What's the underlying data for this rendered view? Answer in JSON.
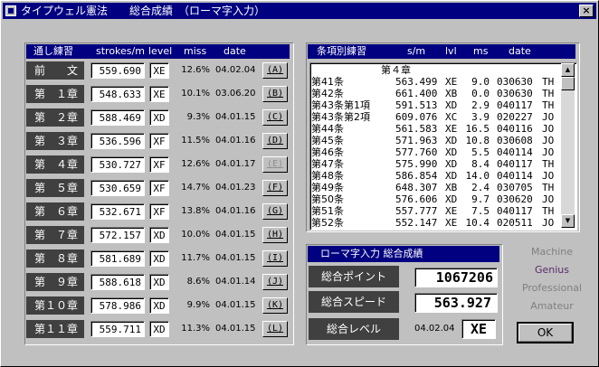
{
  "window": {
    "title": "タイプウェル憲法　　総合成績　（ローマ字入力）",
    "close_glyph": "×"
  },
  "left": {
    "header": {
      "col1": "通し練習",
      "col2": "strokes/m",
      "col3": "level",
      "col4": "miss",
      "col5": "date"
    },
    "rows": [
      {
        "label_a": "前",
        "label_b": "文",
        "spm": "559.690",
        "level": "XE",
        "miss": "12.6%",
        "date": "04.02.04",
        "key": "(A)"
      },
      {
        "label_a": "第",
        "label_b": "１章",
        "spm": "548.633",
        "level": "XE",
        "miss": "10.1%",
        "date": "03.06.20",
        "key": "(B)"
      },
      {
        "label_a": "第",
        "label_b": "２章",
        "spm": "588.469",
        "level": "XD",
        "miss": "9.3%",
        "date": "04.01.15",
        "key": "(C)"
      },
      {
        "label_a": "第",
        "label_b": "３章",
        "spm": "536.596",
        "level": "XF",
        "miss": "11.5%",
        "date": "04.01.16",
        "key": "(D)"
      },
      {
        "label_a": "第",
        "label_b": "４章",
        "spm": "530.727",
        "level": "XF",
        "miss": "12.6%",
        "date": "04.01.17",
        "key": "(E)"
      },
      {
        "label_a": "第",
        "label_b": "５章",
        "spm": "530.659",
        "level": "XF",
        "miss": "14.7%",
        "date": "04.01.23",
        "key": "(F)"
      },
      {
        "label_a": "第",
        "label_b": "６章",
        "spm": "532.671",
        "level": "XF",
        "miss": "13.8%",
        "date": "04.01.16",
        "key": "(G)"
      },
      {
        "label_a": "第",
        "label_b": "７章",
        "spm": "572.157",
        "level": "XD",
        "miss": "10.0%",
        "date": "04.01.15",
        "key": "(H)"
      },
      {
        "label_a": "第",
        "label_b": "８章",
        "spm": "581.689",
        "level": "XD",
        "miss": "11.7%",
        "date": "04.01.15",
        "key": "(I)"
      },
      {
        "label_a": "第",
        "label_b": "９章",
        "spm": "588.618",
        "level": "XD",
        "miss": "8.6%",
        "date": "04.01.14",
        "key": "(J)"
      },
      {
        "label_a": "第",
        "label_b": "１０章",
        "spm": "578.986",
        "level": "XD",
        "miss": "9.9%",
        "date": "04.01.15",
        "key": "(K)"
      },
      {
        "label_a": "第",
        "label_b": "１１章",
        "spm": "559.711",
        "level": "XD",
        "miss": "11.3%",
        "date": "04.01.15",
        "key": "(L)"
      }
    ]
  },
  "right": {
    "header": {
      "col1": "条項別練習",
      "col2": "s/m",
      "col3": "lvl",
      "col4": "ms",
      "col5": "date"
    },
    "chapter": "第４章",
    "items": [
      {
        "name": "第41条",
        "sm": "563.499",
        "lvl": "XE",
        "ms": "9.0",
        "date": "030630",
        "who": "TH"
      },
      {
        "name": "第42条",
        "sm": "661.400",
        "lvl": "XB",
        "ms": "0.0",
        "date": "030630",
        "who": "TH"
      },
      {
        "name": "第43条第1項",
        "sm": "591.513",
        "lvl": "XD",
        "ms": "2.9",
        "date": "040117",
        "who": "TH"
      },
      {
        "name": "第43条第2項",
        "sm": "609.076",
        "lvl": "XC",
        "ms": "3.9",
        "date": "020227",
        "who": "JO"
      },
      {
        "name": "第44条",
        "sm": "561.583",
        "lvl": "XE",
        "ms": "16.5",
        "date": "040116",
        "who": "JO"
      },
      {
        "name": "第45条",
        "sm": "571.963",
        "lvl": "XD",
        "ms": "10.8",
        "date": "030608",
        "who": "JO"
      },
      {
        "name": "第46条",
        "sm": "577.760",
        "lvl": "XD",
        "ms": "5.5",
        "date": "040114",
        "who": "JO"
      },
      {
        "name": "第47条",
        "sm": "575.990",
        "lvl": "XD",
        "ms": "8.4",
        "date": "040117",
        "who": "TH"
      },
      {
        "name": "第48条",
        "sm": "586.854",
        "lvl": "XD",
        "ms": "14.0",
        "date": "040114",
        "who": "JO"
      },
      {
        "name": "第49条",
        "sm": "648.307",
        "lvl": "XB",
        "ms": "2.4",
        "date": "030705",
        "who": "TH"
      },
      {
        "name": "第50条",
        "sm": "576.606",
        "lvl": "XD",
        "ms": "9.7",
        "date": "030620",
        "who": "JO"
      },
      {
        "name": "第51条",
        "sm": "557.777",
        "lvl": "XE",
        "ms": "7.5",
        "date": "040117",
        "who": "TH"
      },
      {
        "name": "第52条",
        "sm": "552.147",
        "lvl": "XE",
        "ms": "10.4",
        "date": "020511",
        "who": "JO"
      }
    ]
  },
  "summary": {
    "title": "ローマ字入力 総合成績",
    "point_label": "総合ポイント",
    "point_value": "1067206",
    "speed_label": "総合スピード",
    "speed_value": "563.927",
    "level_label": "総合レベル",
    "level_date": "04.02.04",
    "level_value": "XE"
  },
  "ranks": [
    {
      "name": "Machine",
      "color": "#808080"
    },
    {
      "name": "Genius",
      "color": "#5a2a6a"
    },
    {
      "name": "Professional",
      "color": "#808080"
    },
    {
      "name": "Amateur",
      "color": "#808080"
    }
  ],
  "ok_label": "OK"
}
